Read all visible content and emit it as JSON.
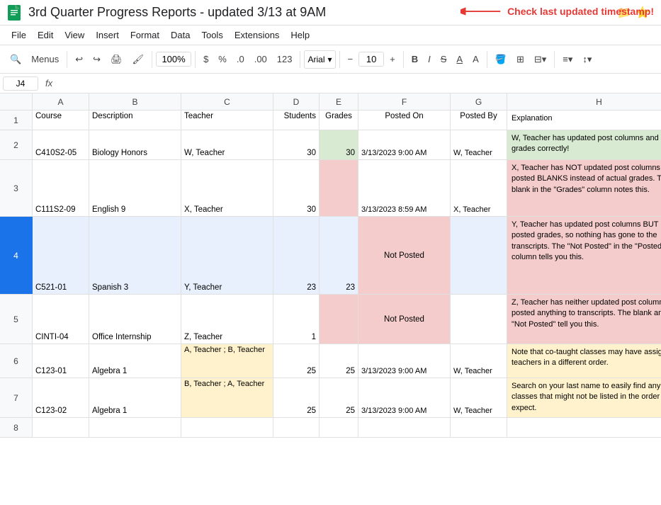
{
  "title": "3rd Quarter Progress Reports - updated 3/13 at 9AM",
  "annotation": "Check last updated timestamp!",
  "menu": {
    "items": [
      "File",
      "Edit",
      "View",
      "Insert",
      "Format",
      "Data",
      "Tools",
      "Extensions",
      "Help"
    ]
  },
  "toolbar": {
    "menus_label": "Menus",
    "zoom": "100%",
    "dollar": "$",
    "percent": "%",
    "decimal_dec": ".0",
    "decimal_inc": ".00",
    "hash": "123",
    "font": "Arial",
    "font_size": "10",
    "bold": "B",
    "italic": "I",
    "strikethrough": "S"
  },
  "formula_bar": {
    "cell_ref": "J4",
    "fx": "fx"
  },
  "columns": {
    "headers": [
      "",
      "A",
      "B",
      "C",
      "D",
      "E",
      "F",
      "G",
      "H"
    ],
    "widths": [
      46,
      80,
      130,
      130,
      65,
      55,
      130,
      80,
      260
    ]
  },
  "row1": {
    "num": "1",
    "a": "Course",
    "b": "Description",
    "c": "Teacher",
    "d": "Students",
    "e": "Grades",
    "f": "Posted On",
    "g": "Posted By",
    "h": "Explanation"
  },
  "row2": {
    "num": "2",
    "a": "C410S2-05",
    "b": "Biology Honors",
    "c": "W, Teacher",
    "d": "30",
    "e": "30",
    "f": "3/13/2023 9:00 AM",
    "g": "W, Teacher",
    "h": "W, Teacher has updated post columns and posted grades correctly!",
    "h_color": "green"
  },
  "row3": {
    "num": "3",
    "a": "C111S2-09",
    "b": "English 9",
    "c": "X, Teacher",
    "d": "30",
    "e": "",
    "f": "3/13/2023 8:59 AM",
    "g": "X, Teacher",
    "h": "X, Teacher has NOT updated post columns and posted BLANKS instead of actual grades. The blank in the \"Grades\" column notes this.",
    "h_color": "red"
  },
  "row4": {
    "num": "4",
    "a": "C521-01",
    "b": "Spanish 3",
    "c": "Y, Teacher",
    "d": "23",
    "e": "23",
    "f": "Not Posted",
    "g": "",
    "h": "Y, Teacher has updated post columns BUT NOT posted grades, so nothing has gone to the transcripts. The \"Not Posted\" in the \"Posted On\" column tells you this.",
    "h_color": "red",
    "selected": true
  },
  "row5": {
    "num": "5",
    "a": "CINTI-04",
    "b": "Office Internship",
    "c": "Z, Teacher",
    "d": "1",
    "e": "",
    "f": "Not Posted",
    "g": "",
    "h": "Z, Teacher has neither updated post columns nor posted anything to transcripts. The blank and the \"Not Posted\" tell you this.",
    "h_color": "red"
  },
  "row6": {
    "num": "6",
    "a": "C123-01",
    "b": "Algebra 1",
    "c": "A, Teacher ; B, Teacher",
    "d": "25",
    "e": "25",
    "f": "3/13/2023 9:00 AM",
    "g": "W, Teacher",
    "h": "Note that co-taught classes may have assigned teachers in a different order.",
    "h_color": "yellow",
    "c_color": "yellow"
  },
  "row7": {
    "num": "7",
    "a": "C123-02",
    "b": "Algebra 1",
    "c": "B, Teacher ; A, Teacher",
    "d": "25",
    "e": "25",
    "f": "3/13/2023 9:00 AM",
    "g": "W, Teacher",
    "h": "Search on your last name to easily find any classes that might not be listed in the order you expect.",
    "h_color": "yellow",
    "c_color": "yellow"
  },
  "row8": {
    "num": "8",
    "a": "",
    "b": "",
    "c": "",
    "d": "",
    "e": "",
    "f": "",
    "g": "",
    "h": ""
  }
}
